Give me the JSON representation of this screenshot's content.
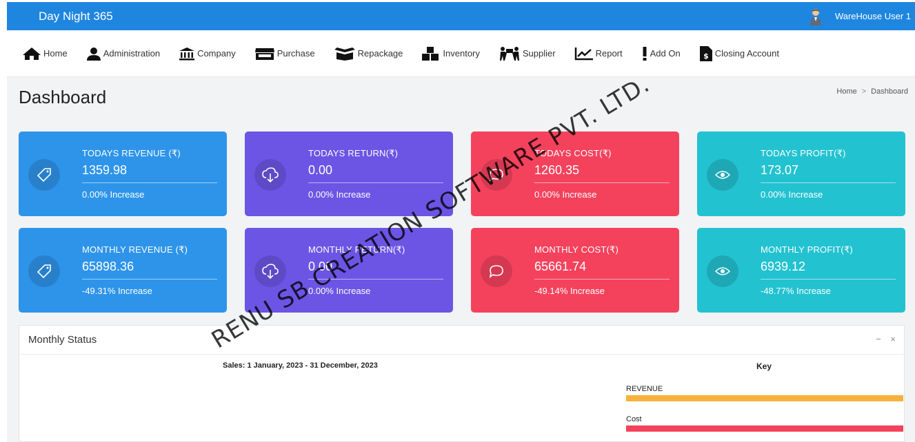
{
  "app": {
    "title": "Day Night 365",
    "user": "WareHouse User 1"
  },
  "nav": {
    "home": "Home",
    "administration": "Administration",
    "company": "Company",
    "purchase": "Purchase",
    "repackage": "Repackage",
    "inventory": "Inventory",
    "supplier": "Supplier",
    "report": "Report",
    "add_on": "Add On",
    "closing_account": "Closing Account"
  },
  "page": {
    "title": "Dashboard",
    "breadcrumb_home": "Home",
    "breadcrumb_sep": ">",
    "breadcrumb_current": "Dashboard"
  },
  "cards": [
    {
      "label": "TODAYS REVENUE (₹)",
      "value": "1359.98",
      "change": "0.00% Increase",
      "color": "#2e94ea",
      "icon": "tag-icon"
    },
    {
      "label": "TODAYS RETURN(₹)",
      "value": "0.00",
      "change": "0.00% Increase",
      "color": "#6c55e4",
      "icon": "cloud-download-icon"
    },
    {
      "label": "TODAYS COST(₹)",
      "value": "1260.35",
      "change": "0.00% Increase",
      "color": "#f4425d",
      "icon": "speech-bubble-icon"
    },
    {
      "label": "TODAYS PROFIT(₹)",
      "value": "173.07",
      "change": "0.00% Increase",
      "color": "#23c2d0",
      "icon": "eye-icon"
    },
    {
      "label": "MONTHLY REVENUE (₹)",
      "value": "65898.36",
      "change": "-49.31% Increase",
      "color": "#2e94ea",
      "icon": "tag-icon"
    },
    {
      "label": "MONTHLY RETURN(₹)",
      "value": "0.00",
      "change": "0.00% Increase",
      "color": "#6c55e4",
      "icon": "cloud-download-icon"
    },
    {
      "label": "MONTHLY COST(₹)",
      "value": "65661.74",
      "change": "-49.14% Increase",
      "color": "#f4425d",
      "icon": "speech-bubble-icon"
    },
    {
      "label": "MONTHLY PROFIT(₹)",
      "value": "6939.12",
      "change": "-48.77% Increase",
      "color": "#23c2d0",
      "icon": "eye-icon"
    }
  ],
  "monthly_status": {
    "title": "Monthly Status",
    "minimize": "−",
    "close": "×",
    "sales_range": "Sales: 1 January, 2023 - 31 December, 2023",
    "key_title": "Key",
    "legend": [
      {
        "label": "REVENUE",
        "color": "#f7b23b"
      },
      {
        "label": "Cost",
        "color": "#f4425d"
      }
    ]
  },
  "watermark": "RENU SB CREATION SOFTWARE PVT. LTD."
}
